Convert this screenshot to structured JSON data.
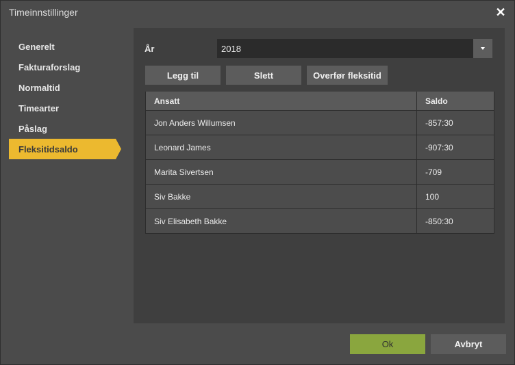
{
  "window": {
    "title": "Timeinnstillinger",
    "close_icon": "close-icon"
  },
  "sidebar": {
    "items": [
      {
        "label": "Generelt",
        "active": false
      },
      {
        "label": "Fakturaforslag",
        "active": false
      },
      {
        "label": "Normaltid",
        "active": false
      },
      {
        "label": "Timearter",
        "active": false
      },
      {
        "label": "Påslag",
        "active": false
      },
      {
        "label": "Fleksitidsaldo",
        "active": true
      }
    ],
    "accent_color": "#ecb92f"
  },
  "year": {
    "label": "År",
    "value": "2018"
  },
  "toolbar": {
    "add_label": "Legg til",
    "delete_label": "Slett",
    "transfer_label": "Overfør fleksitid"
  },
  "table": {
    "headers": [
      "Ansatt",
      "Saldo"
    ],
    "rows": [
      {
        "name": "Jon Anders Willumsen",
        "saldo": "-857:30"
      },
      {
        "name": "Leonard James",
        "saldo": "-907:30"
      },
      {
        "name": "Marita Sivertsen",
        "saldo": "-709"
      },
      {
        "name": "Siv Bakke",
        "saldo": "100"
      },
      {
        "name": "Siv Elisabeth Bakke",
        "saldo": "-850:30"
      }
    ]
  },
  "footer": {
    "ok_label": "Ok",
    "cancel_label": "Avbryt",
    "ok_color": "#8aa63e"
  }
}
